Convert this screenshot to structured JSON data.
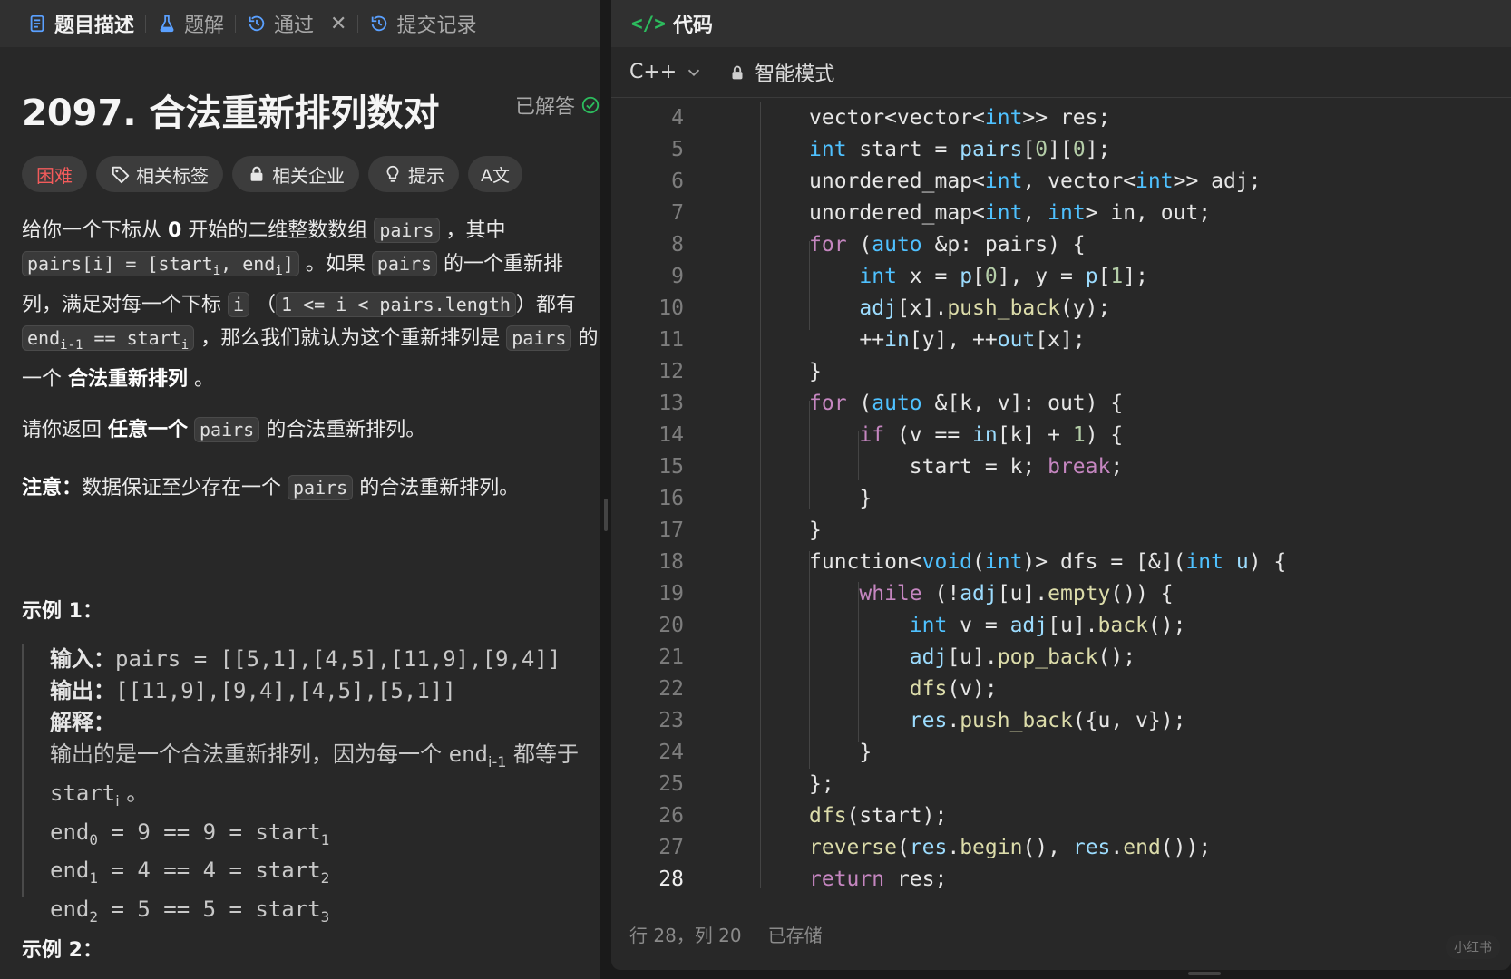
{
  "left_tabs": [
    {
      "label": "题目描述",
      "icon": "doc-icon",
      "active": true
    },
    {
      "label": "题解",
      "icon": "flask-icon"
    },
    {
      "label": "通过",
      "icon": "history-icon"
    },
    {
      "label": "提交记录",
      "icon": "history-icon"
    }
  ],
  "close_glyph": "✕",
  "problem": {
    "title": "2097. 合法重新排列数对",
    "status": "已解答",
    "difficulty": "困难",
    "badges": [
      "相关标签",
      "相关企业",
      "提示"
    ],
    "translate_glyph": "A文"
  },
  "desc": {
    "p1_a": "给你一个下标从 ",
    "p1_b": "0",
    "p1_c": " 开始的二维整数数组 ",
    "p1_code1": "pairs",
    "p1_d": " ，其中 ",
    "p1_code2_a": "pairs[i] = [start",
    "p1_code2_b": "i",
    "p1_code2_c": ", end",
    "p1_code2_d": "i",
    "p1_code2_e": "]",
    "p1_e": " 。如果 ",
    "p1_code3": "pairs",
    "p1_f": " 的一个重新排列，满足对每一个下标 ",
    "p1_code4": "i",
    "p1_g": " （",
    "p1_code5": "1 <= i < pairs.length",
    "p1_h": "）都有 ",
    "p1_code6_a": "end",
    "p1_code6_b": "i-1",
    "p1_code6_c": " == start",
    "p1_code6_d": "i",
    "p1_i": " ，那么我们就认为这个重新排列是 ",
    "p1_code7": "pairs",
    "p1_j": " 的一个 ",
    "p1_k": "合法重新排列",
    "p1_l": " 。",
    "p2_a": "请你返回 ",
    "p2_b": "任意一个",
    "p2_c": " ",
    "p2_code": "pairs",
    "p2_d": " 的合法重新排列。",
    "p3_a": "注意：",
    "p3_b": "数据保证至少存在一个 ",
    "p3_code": "pairs",
    "p3_c": " 的合法重新排列。"
  },
  "example1": {
    "title": "示例 1：",
    "input_label": "输入：",
    "input_value": "pairs = [[5,1],[4,5],[11,9],[9,4]]",
    "output_label": "输出：",
    "output_value": "[[11,9],[9,4],[4,5],[5,1]]",
    "explain_label": "解释：",
    "explain_a": "输出的是一个合法重新排列，因为每一个 ",
    "explain_b": "end",
    "explain_c": "i-1",
    "explain_d": " 都等于 ",
    "explain_e": "start",
    "explain_f": "i",
    "explain_g": " 。",
    "lines": [
      {
        "a": "end",
        "a_sub": "0",
        "b": " = 9 == 9 = start",
        "b_sub": "1"
      },
      {
        "a": "end",
        "a_sub": "1",
        "b": " = 4 == 4 = start",
        "b_sub": "2"
      },
      {
        "a": "end",
        "a_sub": "2",
        "b": " = 5 == 5 = start",
        "b_sub": "3"
      }
    ]
  },
  "example2": {
    "title": "示例 2："
  },
  "editor": {
    "header": "代码",
    "header_glyph": "</>",
    "language": "C++",
    "mode": "智能模式",
    "status_pos": "行 28，列 20",
    "status_saved": "已存储",
    "watermark": "小红书"
  }
}
